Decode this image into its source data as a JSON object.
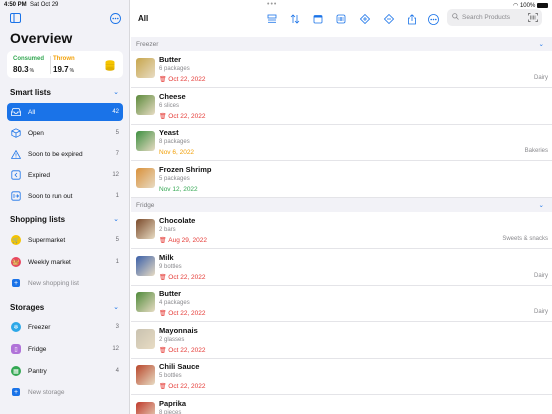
{
  "status": {
    "time": "4:50 PM",
    "date": "Sat Oct 29",
    "battery": "100%"
  },
  "sidebar": {
    "title": "Overview",
    "stats": {
      "consumed_label": "Consumed",
      "consumed_value": "80.3",
      "consumed_unit": "%",
      "thrown_label": "Thrown",
      "thrown_value": "19.7",
      "thrown_unit": "%"
    },
    "smart_lists": {
      "title": "Smart lists",
      "items": [
        {
          "label": "All",
          "count": "42",
          "icon": "tray-icon"
        },
        {
          "label": "Open",
          "count": "5",
          "icon": "box-icon"
        },
        {
          "label": "Soon to be expired",
          "count": "7",
          "icon": "warning-icon"
        },
        {
          "label": "Expired",
          "count": "12",
          "icon": "expired-icon"
        },
        {
          "label": "Soon to run out",
          "count": "1",
          "icon": "run-out-icon"
        }
      ]
    },
    "shopping_lists": {
      "title": "Shopping lists",
      "items": [
        {
          "label": "Supermarket",
          "count": "5",
          "color": "#f5c400"
        },
        {
          "label": "Weekly market",
          "count": "1",
          "color": "#e8455f"
        }
      ],
      "add_label": "New shopping list"
    },
    "storages": {
      "title": "Storages",
      "items": [
        {
          "label": "Freezer",
          "count": "3",
          "color": "#2da8e8"
        },
        {
          "label": "Fridge",
          "count": "12",
          "color": "#b073d8"
        },
        {
          "label": "Pantry",
          "count": "4",
          "color": "#34a853"
        }
      ],
      "add_label": "New storage"
    }
  },
  "main": {
    "title": "All",
    "search_placeholder": "Search Products",
    "groups": [
      {
        "name": "Freezer",
        "items": [
          {
            "name": "Butter",
            "qty": "6 packages",
            "date": "Oct 22, 2022",
            "status": "expired",
            "category": "Dairy",
            "thumb": "#c7a64c"
          },
          {
            "name": "Cheese",
            "qty": "6 slices",
            "date": "Oct 22, 2022",
            "status": "expired",
            "category": "",
            "thumb": "#5c8a3c"
          },
          {
            "name": "Yeast",
            "qty": "8 packages",
            "date": "Nov 6, 2022",
            "status": "soon",
            "category": "Bakeries",
            "thumb": "#3d8f40"
          },
          {
            "name": "Frozen Shrimp",
            "qty": "5 packages",
            "date": "Nov 12, 2022",
            "status": "ok",
            "category": "",
            "thumb": "#d9903a"
          }
        ]
      },
      {
        "name": "Fridge",
        "items": [
          {
            "name": "Chocolate",
            "qty": "2 bars",
            "date": "Aug 29, 2022",
            "status": "expired",
            "category": "Sweets & snacks",
            "thumb": "#7a4a2a"
          },
          {
            "name": "Milk",
            "qty": "9 bottles",
            "date": "Oct 22, 2022",
            "status": "expired",
            "category": "Dairy",
            "thumb": "#3a5fa8"
          },
          {
            "name": "Butter",
            "qty": "4 packages",
            "date": "Oct 22, 2022",
            "status": "expired",
            "category": "Dairy",
            "thumb": "#4f8a3a"
          },
          {
            "name": "Mayonnais",
            "qty": "2 glasses",
            "date": "Oct 22, 2022",
            "status": "expired",
            "category": "",
            "thumb": "#c9c2b0"
          },
          {
            "name": "Chili Sauce",
            "qty": "5 bottles",
            "date": "Oct 22, 2022",
            "status": "expired",
            "category": "",
            "thumb": "#b8462a"
          },
          {
            "name": "Paprika",
            "qty": "8 pieces",
            "date": "",
            "status": "expired",
            "category": "",
            "thumb": "#c0392b"
          }
        ]
      }
    ]
  }
}
